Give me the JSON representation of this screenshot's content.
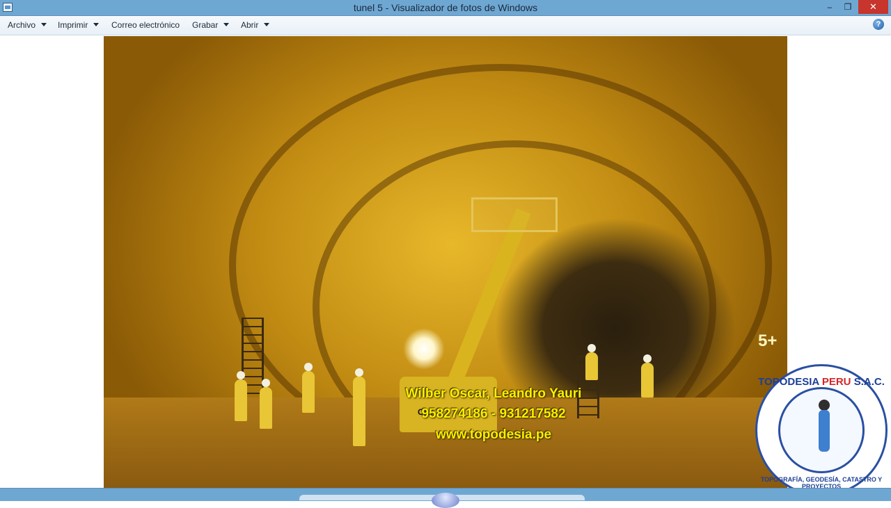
{
  "window": {
    "title": "tunel 5 - Visualizador de fotos de Windows",
    "minimize_glyph": "–",
    "maximize_glyph": "❐",
    "close_glyph": "✕"
  },
  "menu": {
    "items": [
      {
        "label": "Archivo",
        "has_dropdown": true
      },
      {
        "label": "Imprimir",
        "has_dropdown": true
      },
      {
        "label": "Correo electrónico",
        "has_dropdown": false
      },
      {
        "label": "Grabar",
        "has_dropdown": true
      },
      {
        "label": "Abrir",
        "has_dropdown": true
      }
    ],
    "help_glyph": "?"
  },
  "photo": {
    "watermark_lines": [
      "Wilber Oscar, Leandro Yauri",
      "958274186 - 931217582",
      "www.topodesia.pe"
    ],
    "machine_badge": "CAT",
    "wall_marking": "5+"
  },
  "logo": {
    "name_part1": "TOPODESIA",
    "name_part2": "PERU",
    "name_part3": "S.A.C.",
    "tagline": "TOPOGRAFÍA, GEODESÍA, CATASTRO Y PROYECTOS"
  },
  "colors": {
    "titlebar": "#6fa7d3",
    "close_button": "#c7352c",
    "watermark_text": "#f8f000",
    "logo_blue": "#1c3f96",
    "logo_red": "#d3262a"
  }
}
